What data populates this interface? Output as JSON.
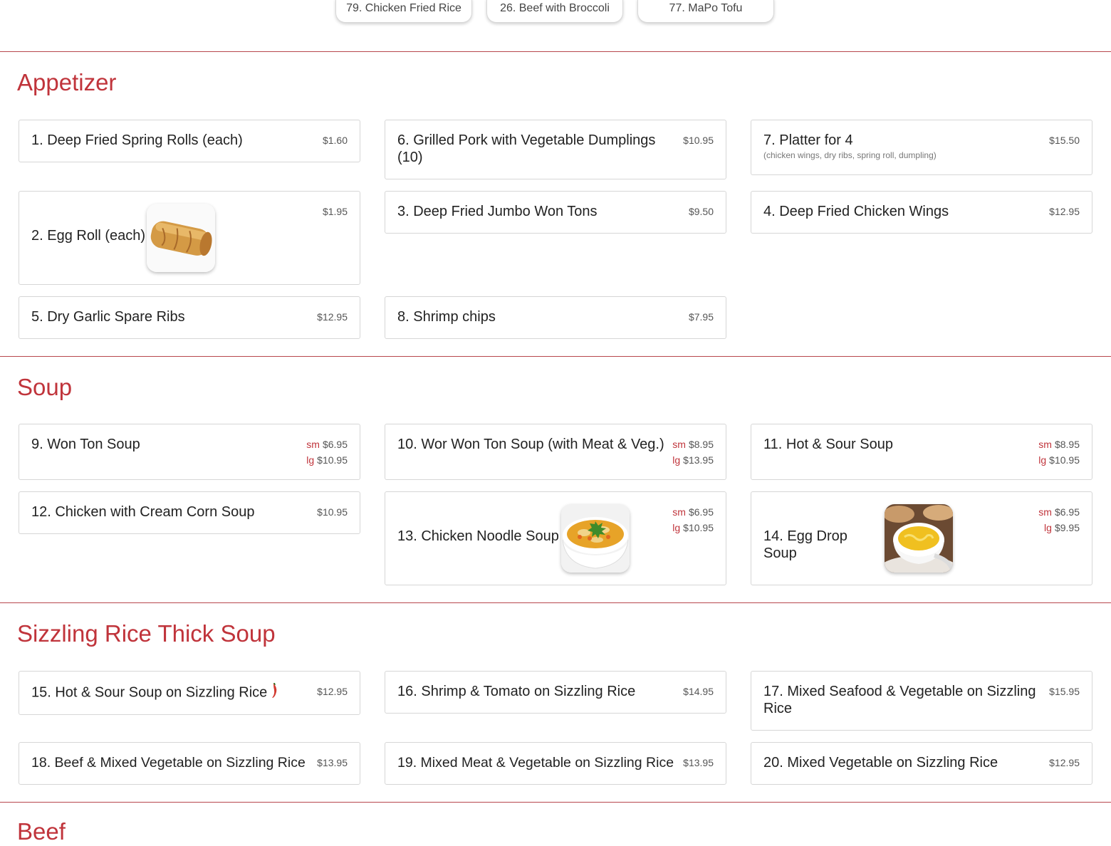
{
  "top_tabs": [
    {
      "label": "79. Chicken Fried Rice"
    },
    {
      "label": "26. Beef with Broccoli"
    },
    {
      "label": "77. MaPo Tofu"
    }
  ],
  "sections": {
    "appetizer": {
      "title": "Appetizer",
      "items": [
        {
          "name": "1. Deep Fried Spring Rolls (each)",
          "price": "$1.60"
        },
        {
          "name": "6. Grilled Pork with Vegetable Dumplings (10)",
          "price": "$10.95"
        },
        {
          "name": "7. Platter for 4",
          "desc": "(chicken wings, dry ribs, spring roll, dumpling)",
          "price": "$15.50"
        },
        {
          "name": "2. Egg Roll (each)",
          "price": "$1.95",
          "image": "egg-roll-photo"
        },
        {
          "name": "3. Deep Fried Jumbo Won Tons",
          "price": "$9.50"
        },
        {
          "name": "4. Deep Fried Chicken Wings",
          "price": "$12.95"
        },
        {
          "name": "5. Dry Garlic Spare Ribs",
          "price": "$12.95"
        },
        {
          "name": "8. Shrimp chips",
          "price": "$7.95"
        }
      ]
    },
    "soup": {
      "title": "Soup",
      "size_sm": "sm",
      "size_lg": "lg",
      "items": [
        {
          "name": "9. Won Ton Soup",
          "sm": "$6.95",
          "lg": "$10.95"
        },
        {
          "name": "10. Wor Won Ton Soup (with Meat & Veg.)",
          "sm": "$8.95",
          "lg": "$13.95"
        },
        {
          "name": "11. Hot & Sour Soup",
          "sm": "$8.95",
          "lg": "$10.95"
        },
        {
          "name": "12. Chicken with Cream Corn Soup",
          "price": "$10.95"
        },
        {
          "name": "13. Chicken Noodle Soup",
          "sm": "$6.95",
          "lg": "$10.95",
          "image": "chicken-noodle-soup-photo"
        },
        {
          "name": "14. Egg Drop Soup",
          "sm": "$6.95",
          "lg": "$9.95",
          "image": "egg-drop-soup-photo"
        }
      ]
    },
    "sizzling": {
      "title": "Sizzling Rice Thick Soup",
      "items": [
        {
          "name": "15. Hot & Sour Soup on Sizzling Rice",
          "price": "$12.95",
          "icon": "chili-pepper-icon"
        },
        {
          "name": "16. Shrimp & Tomato on Sizzling Rice",
          "price": "$14.95"
        },
        {
          "name": "17. Mixed Seafood & Vegetable on Sizzling Rice",
          "price": "$15.95"
        },
        {
          "name": "18. Beef & Mixed Vegetable on Sizzling Rice",
          "price": "$13.95"
        },
        {
          "name": "19. Mixed Meat & Vegetable on Sizzling Rice",
          "price": "$13.95"
        },
        {
          "name": "20. Mixed Vegetable on Sizzling Rice",
          "price": "$12.95"
        }
      ]
    },
    "beef": {
      "title": "Beef"
    }
  },
  "colors": {
    "accent": "#c0343b",
    "rule": "#b8474d",
    "border": "#d6d6d6"
  }
}
